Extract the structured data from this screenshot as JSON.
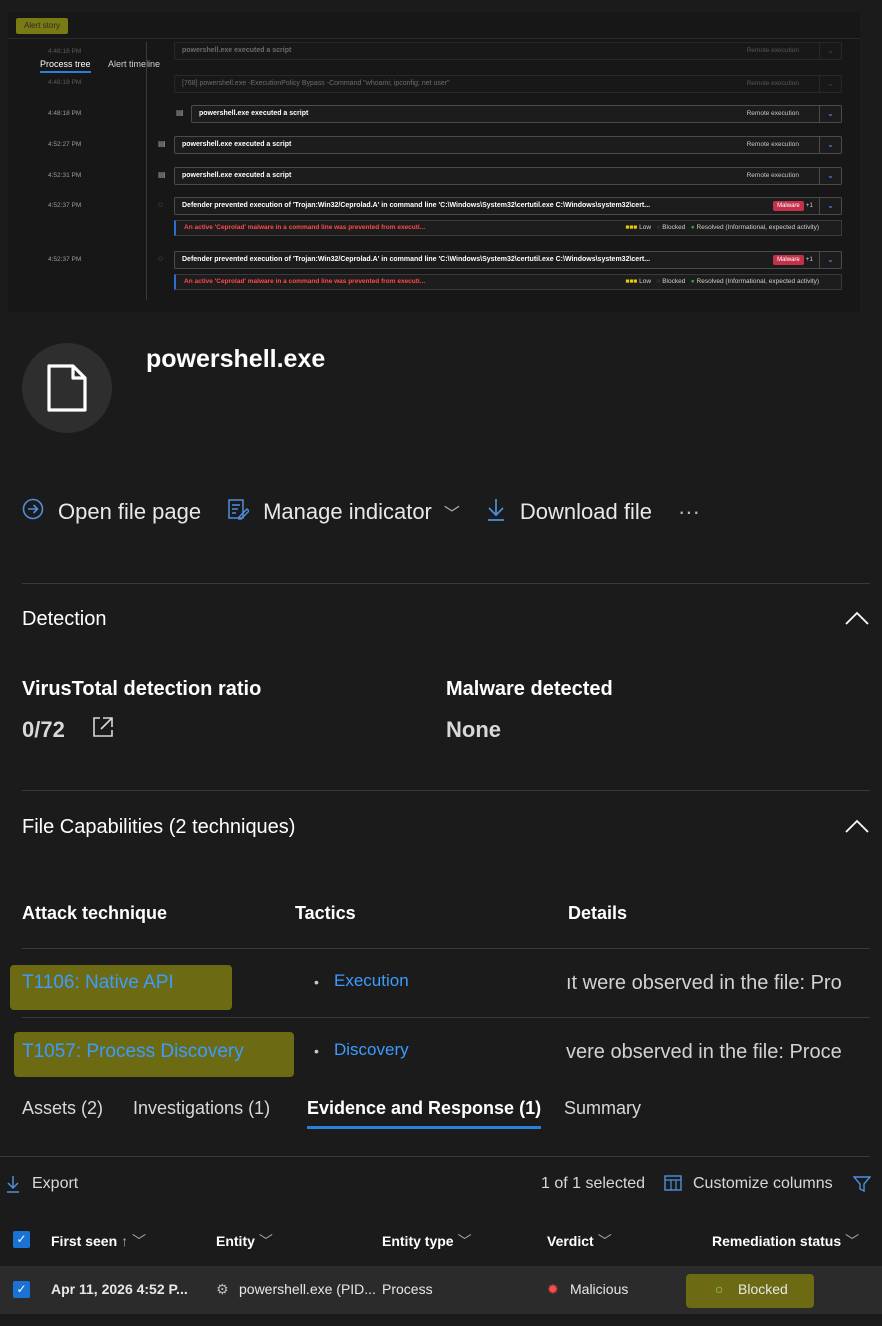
{
  "alert_story": {
    "label": "Alert story",
    "tabs": [
      "Process tree",
      "Alert timeline"
    ],
    "events": [
      {
        "time": "4:48:18 PM",
        "text": "powershell.exe executed a script",
        "tag": "Remote execution"
      },
      {
        "time": "4:48:18 PM",
        "text": "[768] powershell.exe -ExecutionPolicy Bypass -Command \"whoami; ipconfig; net user\"",
        "tag": "Remote execution"
      },
      {
        "time": "4:48:18 PM",
        "text": "powershell.exe executed a script",
        "tag": "Remote execution"
      },
      {
        "time": "4:52:27 PM",
        "text": "powershell.exe executed a script",
        "tag": "Remote execution"
      },
      {
        "time": "4:52:31 PM",
        "text": "powershell.exe executed a script",
        "tag": "Remote execution"
      },
      {
        "time": "4:52:37 PM",
        "text": "Defender prevented execution of 'Trojan:Win32/Ceprolad.A' in command line 'C:\\Windows\\System32\\certutil.exe C:\\Windows\\system32\\cert...",
        "badge": "Malware",
        "extra": "+1",
        "alert": "An active 'Ceprolad' malware in a command line was prevented from executi...",
        "severity": "Low",
        "status": "Blocked",
        "classification": "Resolved (Informational, expected activity)"
      },
      {
        "time": "4:52:37 PM",
        "text": "Defender prevented execution of 'Trojan:Win32/Ceprolad.A' in command line 'C:\\Windows\\System32\\certutil.exe C:\\Windows\\system32\\cert...",
        "badge": "Malware",
        "extra": "+1",
        "alert": "An active 'Ceprolad' malware in a command line was prevented from executi...",
        "severity": "Low",
        "status": "Blocked",
        "classification": "Resolved (Informational, expected activity)"
      }
    ]
  },
  "file": {
    "name": "powershell.exe",
    "icon": "file-icon"
  },
  "actions": {
    "open": "Open file page",
    "manage": "Manage indicator",
    "download": "Download file",
    "more": "···"
  },
  "detection": {
    "heading": "Detection",
    "vt_label": "VirusTotal detection ratio",
    "vt_value": "0/72",
    "malware_label": "Malware detected",
    "malware_value": "None"
  },
  "capabilities": {
    "heading": "File Capabilities (2 techniques)",
    "columns": [
      "Attack technique",
      "Tactics",
      "Details"
    ],
    "rows": [
      {
        "technique": "T1106: Native API",
        "tactic": "Execution",
        "details": "ıt were observed in the file: Pro"
      },
      {
        "technique": "T1057: Process Discovery",
        "tactic": "Discovery",
        "details": "vere observed in the file: Proce"
      }
    ]
  },
  "bottom_tabs": [
    "Assets (2)",
    "Investigations (1)",
    "Evidence and Response (1)",
    "Summary"
  ],
  "toolbar": {
    "export": "Export",
    "selected": "1 of 1 selected",
    "customize": "Customize columns"
  },
  "table": {
    "columns": [
      "First seen",
      "Entity",
      "Entity type",
      "Verdict",
      "Remediation status"
    ],
    "row": {
      "first_seen": "Apr 11, 2026 4:52 P...",
      "entity": "powershell.exe (PID...",
      "entity_type": "Process",
      "verdict": "Malicious",
      "remediation": "Blocked"
    }
  },
  "colors": {
    "accent": "#2a7fd8",
    "link": "#3d9bff",
    "highlight": "#6c6b14",
    "danger": "#ff4a4a"
  }
}
